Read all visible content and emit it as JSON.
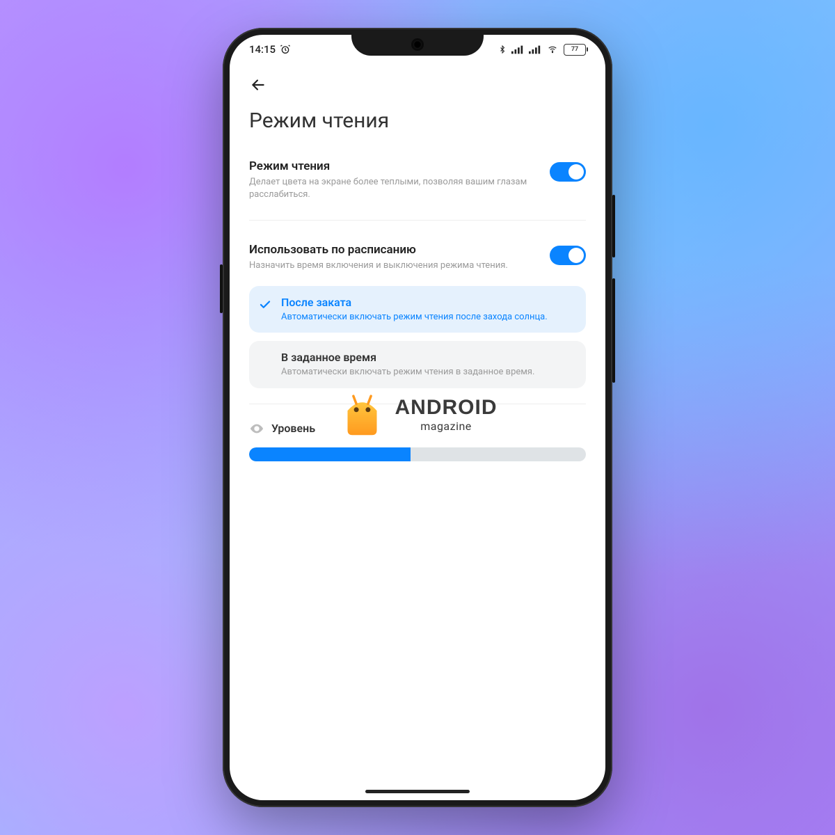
{
  "statusbar": {
    "time": "14:15",
    "battery_text": "77"
  },
  "page": {
    "title": "Режим чтения"
  },
  "settings": {
    "reading_mode": {
      "title": "Режим чтения",
      "desc": "Делает цвета на экране более теплыми, позволяя вашим глазам расслабиться.",
      "enabled": true
    },
    "schedule": {
      "title": "Использовать по расписанию",
      "desc": "Назначить время включения и выключения режима чтения.",
      "enabled": true
    }
  },
  "schedule_options": [
    {
      "id": "after_sunset",
      "title": "После заката",
      "desc": "Автоматически включать режим чтения после захода солнца.",
      "selected": true
    },
    {
      "id": "custom_time",
      "title": "В заданное время",
      "desc": "Автоматически включать режим чтения в заданное время.",
      "selected": false
    }
  ],
  "level": {
    "label": "Уровень",
    "value_percent": 48
  },
  "watermark": {
    "brand": "ANDROID",
    "sub": "magazine"
  },
  "colors": {
    "accent": "#0a84ff"
  }
}
